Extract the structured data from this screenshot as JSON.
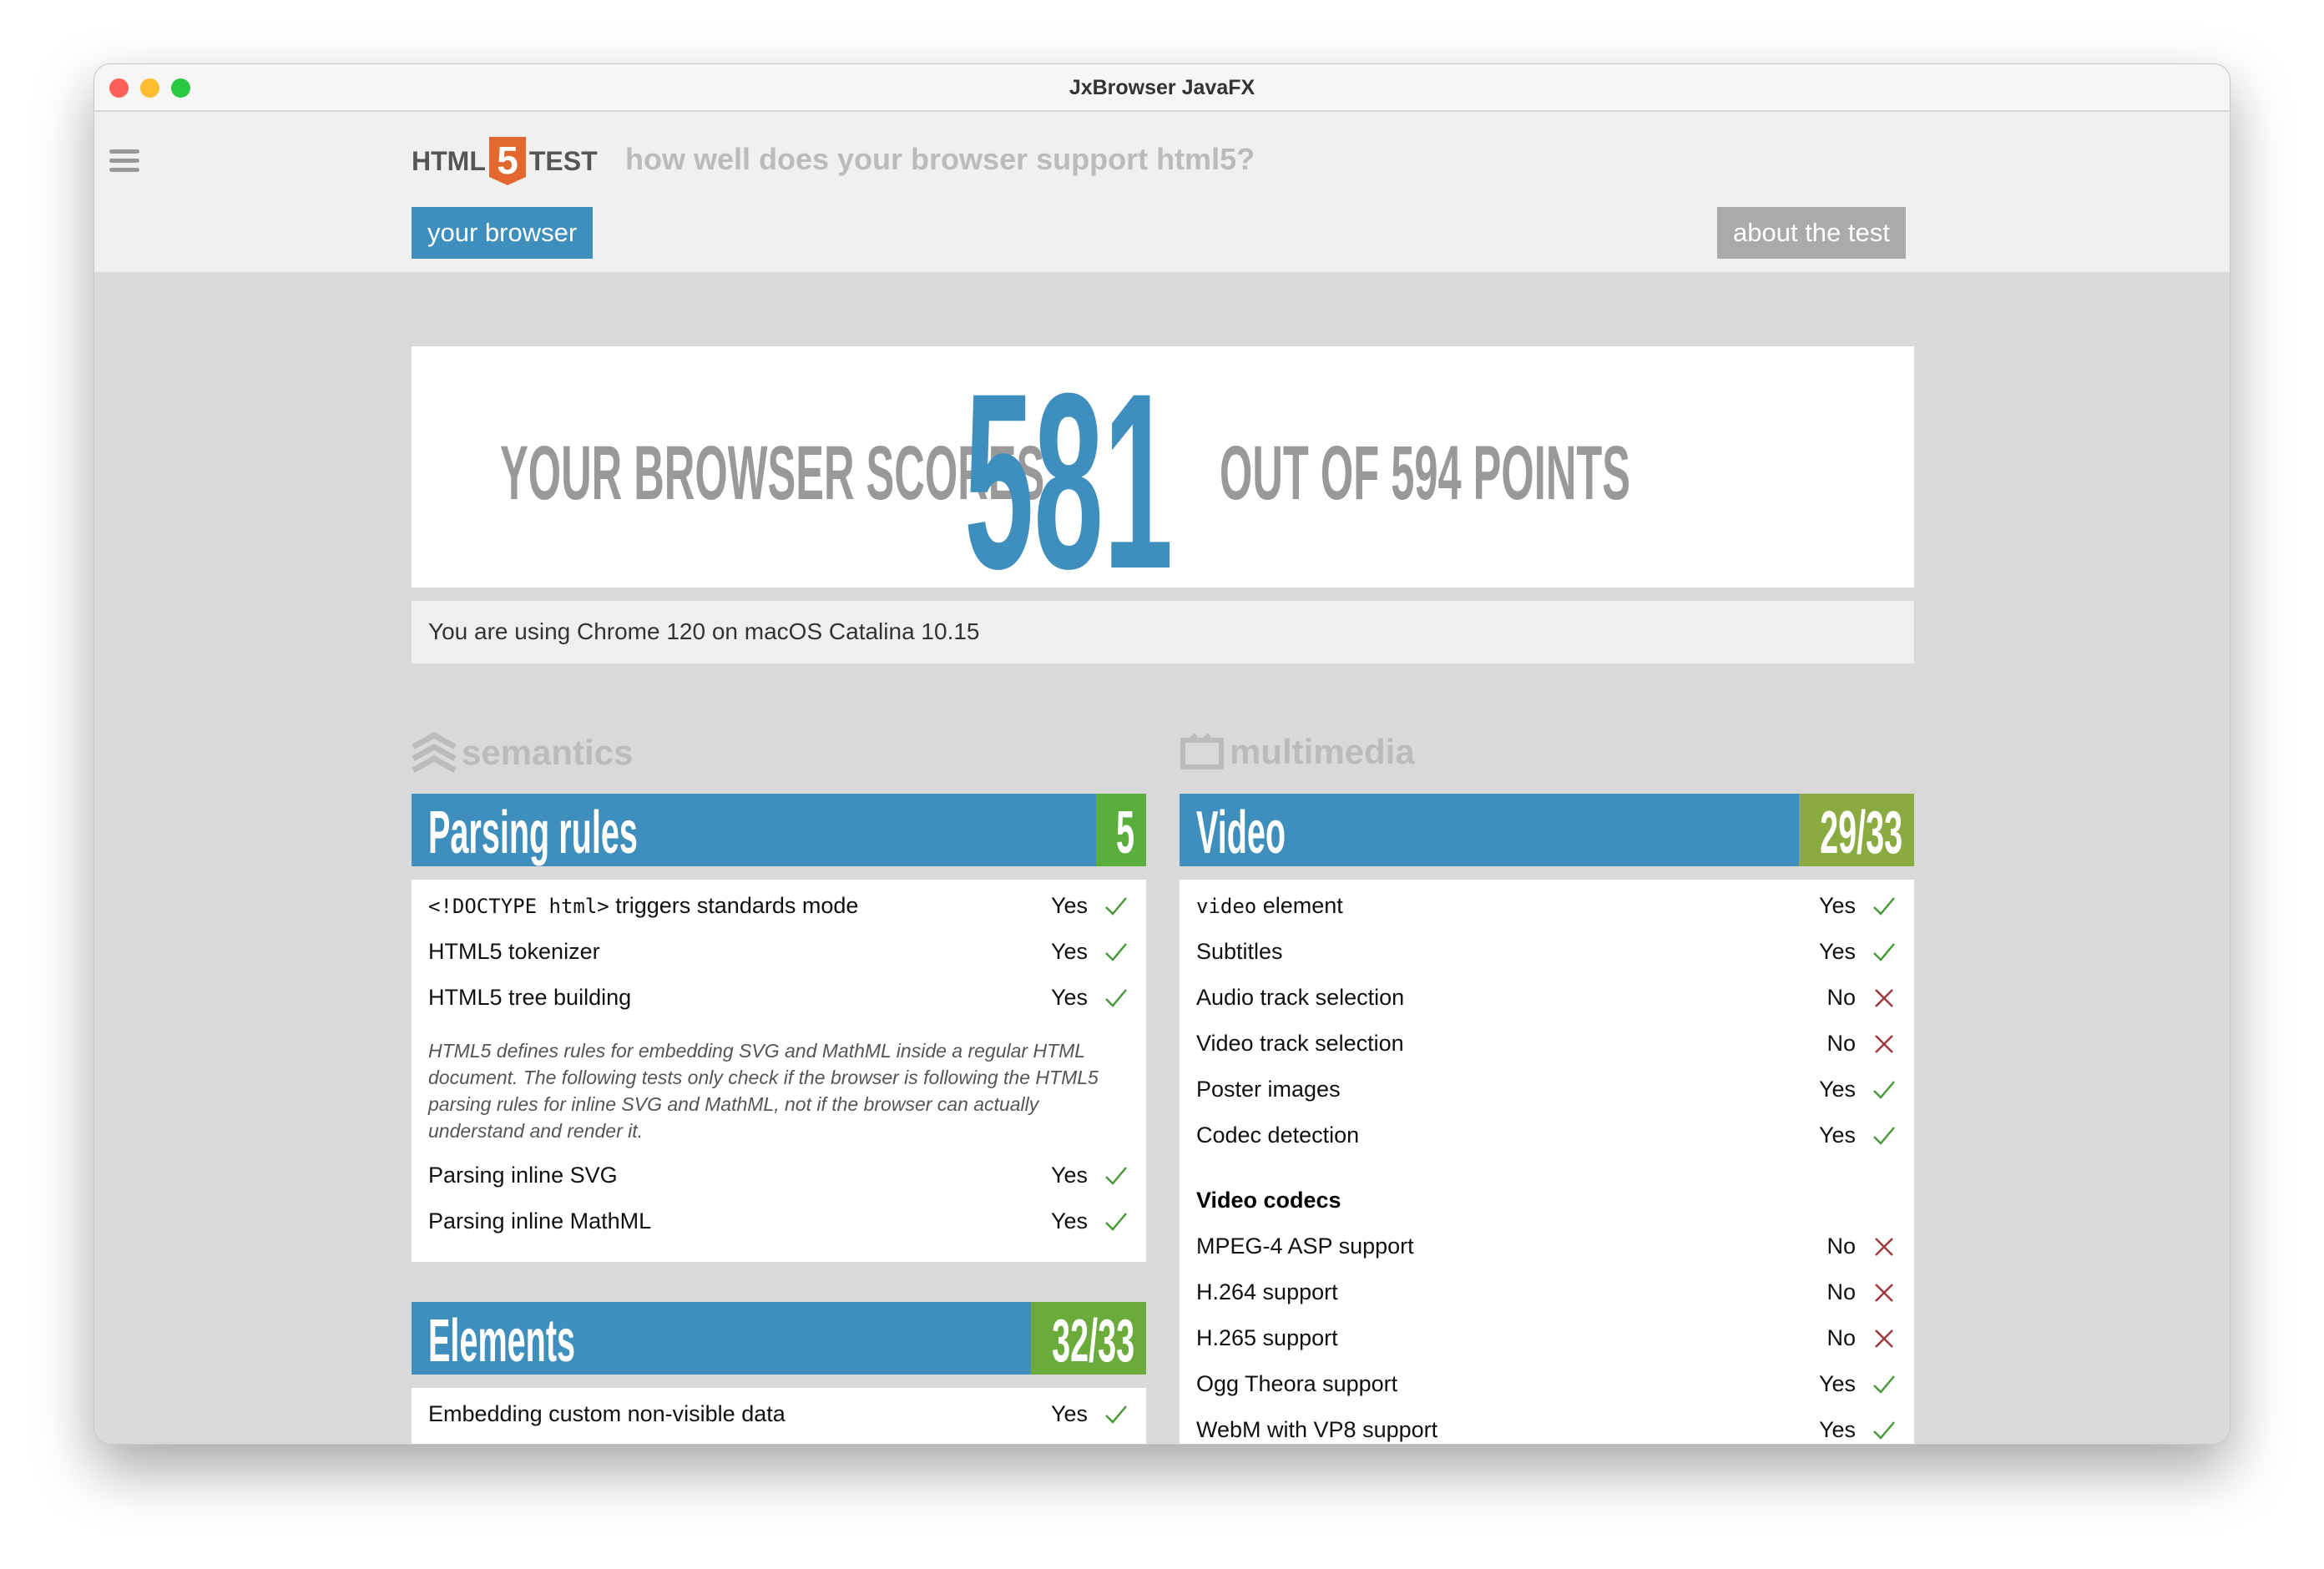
{
  "window": {
    "title": "JxBrowser JavaFX"
  },
  "header": {
    "logo_left": "HTML",
    "logo_num": "5",
    "logo_right": "TEST",
    "tagline": "how well does your browser support html5?",
    "your_browser": "your browser",
    "about": "about the test"
  },
  "score": {
    "prefix": "YOUR BROWSER SCORES",
    "value": "581",
    "suffix": "OUT OF 594 POINTS"
  },
  "info": "You are using Chrome 120 on macOS Catalina 10.15",
  "colors": {
    "blue": "#3f8fbe",
    "green": "#5aae3c",
    "olive": "#8aab3f",
    "yes": "#4a9a3a",
    "no": "#a33a3a"
  },
  "semantics": {
    "label": "semantics",
    "icon": "semantics-chevrons-icon",
    "parsing": {
      "title": "Parsing rules",
      "score": "5",
      "rows": [
        {
          "code": "<!DOCTYPE html>",
          "label": " triggers standards mode",
          "result": "Yes"
        },
        {
          "label": "HTML5 tokenizer",
          "result": "Yes"
        },
        {
          "label": "HTML5 tree building",
          "result": "Yes"
        }
      ],
      "note": "HTML5 defines rules for embedding SVG and MathML inside a regular HTML document. The following tests only check if the browser is following the HTML5 parsing rules for inline SVG and MathML, not if the browser can actually understand and render it.",
      "rows2": [
        {
          "label": "Parsing inline SVG",
          "result": "Yes"
        },
        {
          "label": "Parsing inline MathML",
          "result": "Yes"
        }
      ]
    },
    "elements": {
      "title": "Elements",
      "score": "32/33",
      "rows": [
        {
          "label": "Embedding custom non-visible data",
          "result": "Yes"
        }
      ]
    }
  },
  "multimedia": {
    "label": "multimedia",
    "icon": "film-icon",
    "video": {
      "title": "Video",
      "score": "29/33",
      "rows": [
        {
          "code": "video",
          "label": " element",
          "result": "Yes"
        },
        {
          "label": "Subtitles",
          "result": "Yes"
        },
        {
          "label": "Audio track selection",
          "result": "No"
        },
        {
          "label": "Video track selection",
          "result": "No"
        },
        {
          "label": "Poster images",
          "result": "Yes"
        },
        {
          "label": "Codec detection",
          "result": "Yes"
        }
      ],
      "codecs_heading": "Video codecs",
      "codecs": [
        {
          "label": "MPEG-4 ASP support",
          "result": "No"
        },
        {
          "label": "H.264 support",
          "result": "No"
        },
        {
          "label": "H.265 support",
          "result": "No"
        },
        {
          "label": "Ogg Theora support",
          "result": "Yes"
        },
        {
          "label": "WebM with VP8 support",
          "result": "Yes"
        }
      ]
    }
  }
}
